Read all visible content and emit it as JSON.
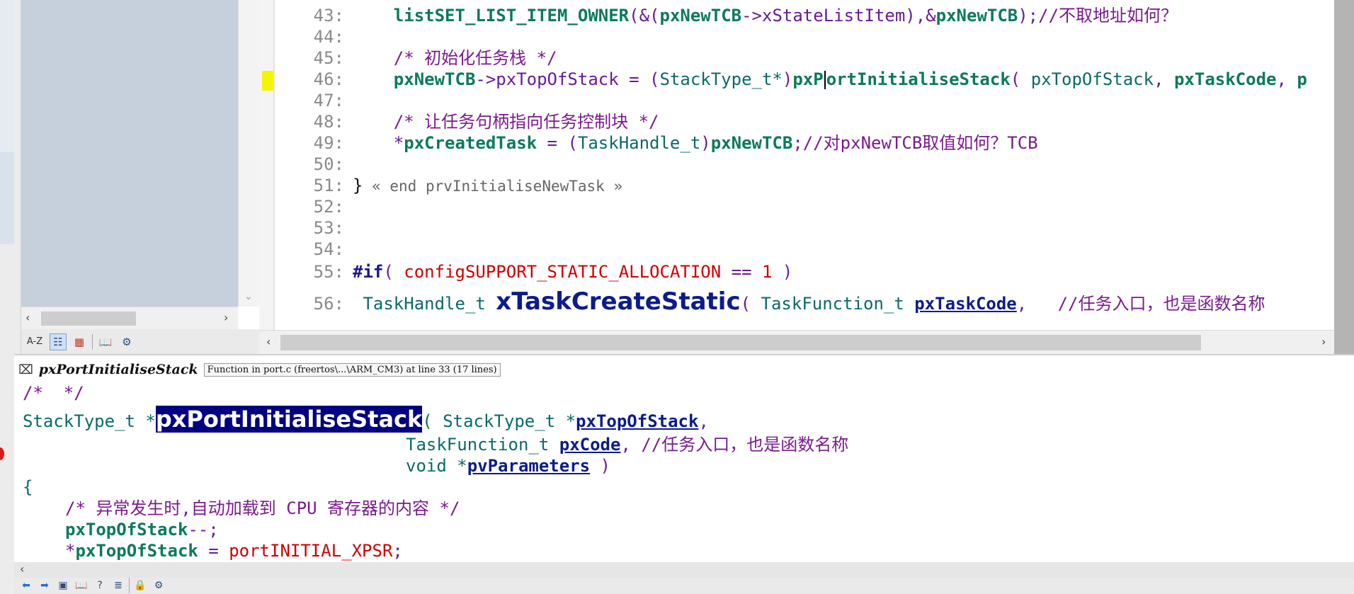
{
  "editor": {
    "lines": [
      {
        "num": "43:"
      },
      {
        "num": "44:"
      },
      {
        "num": "45:"
      },
      {
        "num": "46:"
      },
      {
        "num": "47:"
      },
      {
        "num": "48:"
      },
      {
        "num": "49:"
      },
      {
        "num": "50:"
      },
      {
        "num": "51:"
      },
      {
        "num": "52:"
      },
      {
        "num": "53:"
      },
      {
        "num": "54:"
      },
      {
        "num": "55:"
      },
      {
        "num": "56:"
      }
    ],
    "l43": {
      "fn": "listSET_LIST_ITEM_OWNER",
      "p1": "(&(",
      "a1": "pxNewTCB",
      "p2": "->xStateListItem),&",
      "a2": "pxNewTCB",
      "p3": ");",
      "comment": "//不取地址如何？"
    },
    "l45": {
      "comment": "/* 初始化任务栈 */"
    },
    "l46": {
      "a1": "pxNewTCB",
      "p1": "->pxTopOfStack = (",
      "ty": "StackType_t*",
      "p2": ")",
      "fn_a": "pxP",
      "fn_b": "ortInitialiseStack",
      "p3": "( ",
      "arg1": "pxTopOfStack",
      "p4": ", ",
      "arg2": "pxTaskCode",
      "p5": ", ",
      "arg3": "p"
    },
    "l48": {
      "comment": "/* 让任务句柄指向任务控制块 */"
    },
    "l49": {
      "p1": "*",
      "a1": "pxCreatedTask",
      "p2": " = (",
      "ty": "TaskHandle_t",
      "p3": ")",
      "a2": "pxNewTCB",
      "comment": ";//对pxNewTCB取值如何？TCB"
    },
    "l51": {
      "brace": "}",
      "fold": " « end prvInitialiseNewTask »"
    },
    "l55": {
      "kw": "#if",
      "p1": "( ",
      "macro": "configSUPPORT_STATIC_ALLOCATION",
      "p2": " == ",
      "num": "1",
      "p3": " )"
    },
    "l56": {
      "ty": "TaskHandle_t",
      "fn": "xTaskCreateStatic",
      "p1": "( ",
      "ty2": "TaskFunction_t",
      "arg": "pxTaskCode",
      "p2": ",",
      "comment": "//任务入口，也是函数名称"
    }
  },
  "context": {
    "symbol_name": "pxPortInitialiseStack",
    "symbol_info": "Function in port.c (freertos\\...\\ARM_CM3) at line 33 (17 lines)",
    "c1": "/*  */",
    "c2": {
      "ty": "StackType_t *",
      "fn": "pxPortInitialiseStack",
      "p1": "( StackType_t *",
      "arg": "pxTopOfStack",
      "p2": ","
    },
    "c3": {
      "ty": "TaskFunction_t ",
      "arg": "pxCode",
      "p": ", ",
      "comment": "//任务入口，也是函数名称"
    },
    "c4": {
      "ty": "void *",
      "arg": "pvParameters",
      "p": " )"
    },
    "c5": "{",
    "c6": "/* 异常发生时,自动加载到 CPU 寄存器的内容 */",
    "c7": {
      "a": "pxTopOfStack",
      "p": "--;"
    },
    "c8": {
      "p1": "*",
      "a": "pxTopOfStack",
      "p2": " = ",
      "macro": "portINITIAL_XPSR",
      "p3": ";"
    }
  },
  "toolbar": {
    "az_label": "A-Z",
    "icons": [
      "sort-az-icon",
      "list-view-icon",
      "category-view-icon",
      "book-icon",
      "settings-icon"
    ]
  },
  "context_toolbar": {
    "icons": [
      "back-arrow-icon",
      "forward-arrow-icon",
      "jump-icon",
      "book-icon",
      "lookup-icon",
      "reference-icon",
      "lock-icon",
      "settings-icon"
    ]
  }
}
